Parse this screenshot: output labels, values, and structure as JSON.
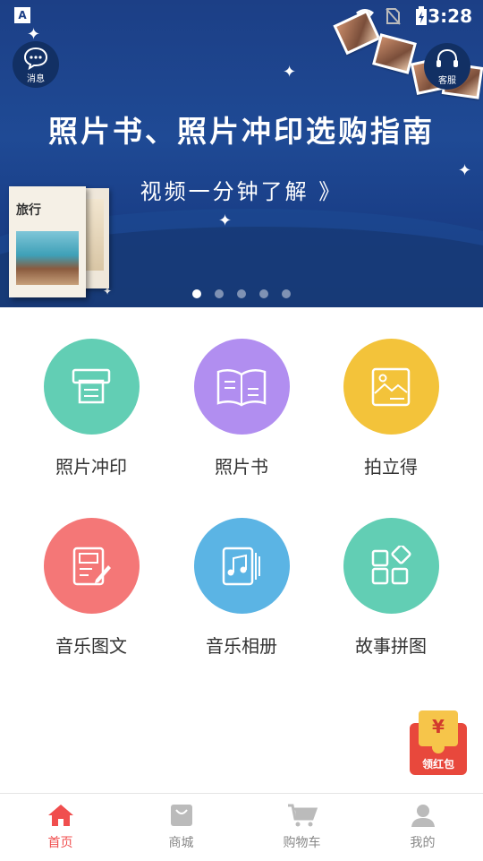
{
  "status_bar": {
    "time": "3:28"
  },
  "banner": {
    "message_label": "消息",
    "service_label": "客服",
    "headline": "照片书、照片冲印选购指南",
    "subline": "视频一分钟了解 》",
    "book_title": "旅行",
    "dots": 5,
    "active_dot": 0
  },
  "grid": {
    "items": [
      {
        "label": "照片冲印",
        "icon": "printer-icon",
        "color": "#62ceb4"
      },
      {
        "label": "照片书",
        "icon": "book-icon",
        "color": "#b18ef0"
      },
      {
        "label": "拍立得",
        "icon": "image-icon",
        "color": "#f3c33a"
      },
      {
        "label": "音乐图文",
        "icon": "edit-document-icon",
        "color": "#f47777"
      },
      {
        "label": "音乐相册",
        "icon": "music-album-icon",
        "color": "#5bb4e4"
      },
      {
        "label": "故事拼图",
        "icon": "puzzle-tiles-icon",
        "color": "#62ceb4"
      }
    ]
  },
  "red_packet": {
    "yen": "¥",
    "label": "领红包"
  },
  "tabbar": {
    "tabs": [
      {
        "label": "首页",
        "icon": "home-icon",
        "active": true
      },
      {
        "label": "商城",
        "icon": "shopping-bag-icon",
        "active": false
      },
      {
        "label": "购物车",
        "icon": "cart-icon",
        "active": false
      },
      {
        "label": "我的",
        "icon": "user-icon",
        "active": false
      }
    ]
  },
  "colors": {
    "accent": "#f04e4e",
    "banner": "#1f4a95"
  }
}
